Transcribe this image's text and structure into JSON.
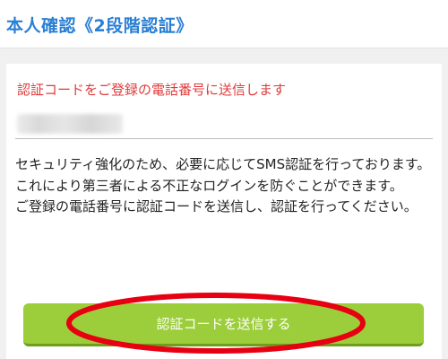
{
  "header": {
    "title": "本人確認《2段階認証》"
  },
  "main": {
    "notice": "認証コードをご登録の電話番号に送信します",
    "description": [
      "セキュリティ強化のため、必要に応じてSMS認証を行っております。",
      "これにより第三者による不正なログインを防ぐことができます。",
      "ご登録の電話番号に認証コードを送信し、認証を行ってください。"
    ],
    "send_button_label": "認証コードを送信する"
  },
  "colors": {
    "title": "#2a7fd4",
    "notice": "#e03b3b",
    "button": "#9ccd3a",
    "highlight": "#e60012"
  }
}
